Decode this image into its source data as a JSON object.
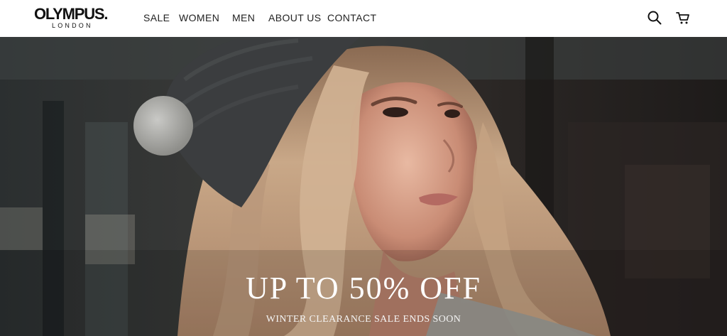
{
  "brand": {
    "name": "OLYMPUS.",
    "tagline": "LONDON"
  },
  "nav": {
    "items": [
      {
        "label": "SALE"
      },
      {
        "label": "WOMEN"
      },
      {
        "label": "MEN"
      },
      {
        "label": "ABOUT US"
      },
      {
        "label": "CONTACT"
      }
    ]
  },
  "header_icons": {
    "search": "search-icon",
    "cart": "cart-icon"
  },
  "hero": {
    "headline": "UP TO 50% OFF",
    "subheadline": "WINTER CLEARANCE SALE ENDS SOON",
    "image": "woman-in-knit-beanie-photo"
  },
  "colors": {
    "header_bg": "#ffffff",
    "text_dark": "#222222",
    "hero_text": "#ffffff"
  }
}
